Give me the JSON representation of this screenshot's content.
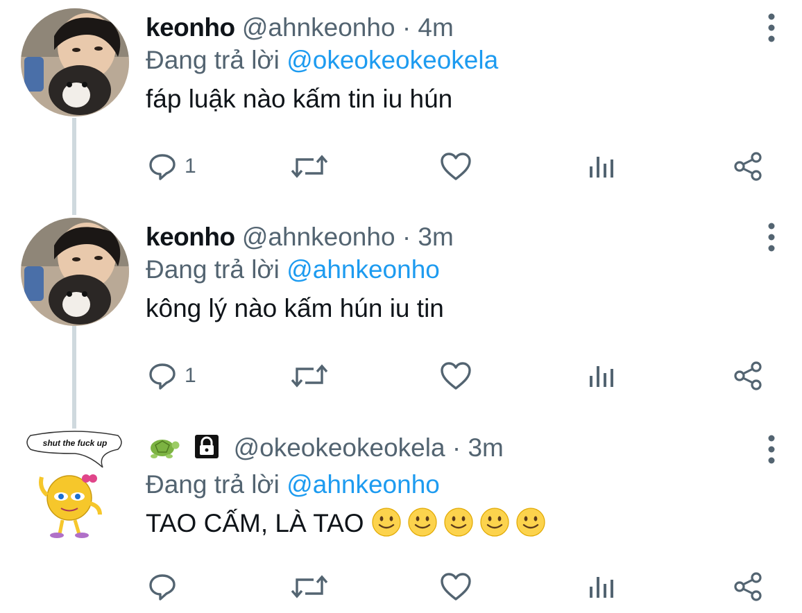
{
  "colors": {
    "text_primary": "#0f1419",
    "text_secondary": "#536471",
    "mention": "#1d9bf0",
    "thread_line": "#cfd9de",
    "emoji_yellow": "#fcd34d"
  },
  "tweets": [
    {
      "display_name": "keonho",
      "handle": "@ahnkeonho",
      "separator": "·",
      "time": "4m",
      "replying_prefix": "Đang trả lời",
      "replying_to": "@okeokeokeokela",
      "text": "fáp luậk nào kấm tin iu hún",
      "reply_count": "1",
      "avatar": "person-with-dog-avatar"
    },
    {
      "display_name": "keonho",
      "handle": "@ahnkeonho",
      "separator": "·",
      "time": "3m",
      "replying_prefix": "Đang trả lời",
      "replying_to": "@ahnkeonho",
      "text": "kông lý nào kấm hún iu tin",
      "reply_count": "1",
      "avatar": "person-with-dog-avatar"
    },
    {
      "display_name_icons": [
        "turtle-emoji",
        "lock-icon"
      ],
      "handle": "@okeokeokeokela",
      "separator": "·",
      "time": "3m",
      "replying_prefix": "Đang trả lời",
      "replying_to": "@ahnkeonho",
      "text": "TAO CẤM, LÀ TAO",
      "text_emojis": [
        "slightly-smiling-face",
        "slightly-smiling-face",
        "slightly-smiling-face",
        "slightly-smiling-face",
        "slightly-smiling-face"
      ],
      "reply_count": "",
      "avatar": "emoji-meme-avatar",
      "avatar_caption": "shut the fuck up"
    }
  ],
  "icons": {
    "reply": "reply-bubble-icon",
    "retweet": "retweet-icon",
    "like": "heart-icon",
    "views": "views-bars-icon",
    "share": "share-icon",
    "more": "more-vertical-icon"
  }
}
